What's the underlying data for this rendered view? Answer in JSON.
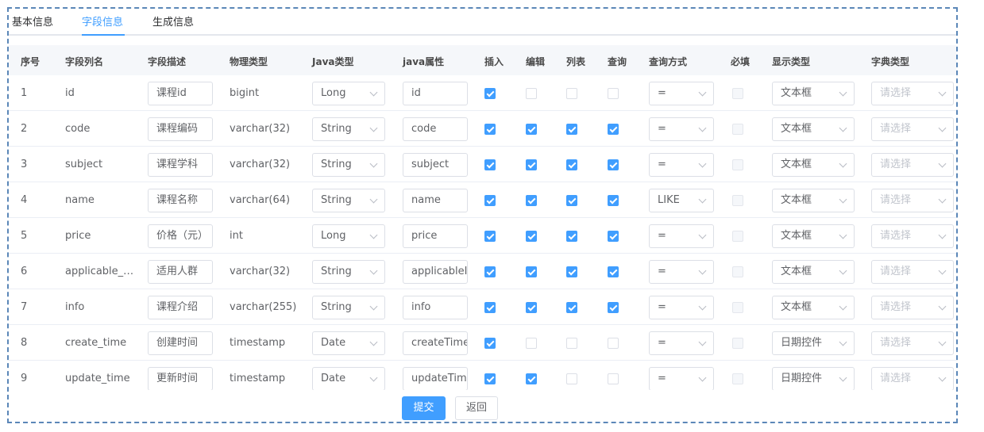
{
  "tabs": [
    {
      "label": "基本信息",
      "active": false
    },
    {
      "label": "字段信息",
      "active": true
    },
    {
      "label": "生成信息",
      "active": false
    }
  ],
  "table": {
    "headers": {
      "index": "序号",
      "column_name": "字段列名",
      "description": "字段描述",
      "physical_type": "物理类型",
      "java_type": "Java类型",
      "java_field": "java属性",
      "insert": "插入",
      "edit": "编辑",
      "list": "列表",
      "query": "查询",
      "query_type": "查询方式",
      "required": "必填",
      "display_type": "显示类型",
      "dict_type": "字典类型"
    },
    "dict_placeholder": "请选择",
    "rows": [
      {
        "index": "1",
        "column_name": "id",
        "description": "课程id",
        "physical_type": "bigint",
        "java_type": "Long",
        "java_field": "id",
        "insert": true,
        "edit": false,
        "list": false,
        "query": false,
        "query_type": "=",
        "required": false,
        "display_type": "文本框"
      },
      {
        "index": "2",
        "column_name": "code",
        "description": "课程编码",
        "physical_type": "varchar(32)",
        "java_type": "String",
        "java_field": "code",
        "insert": true,
        "edit": true,
        "list": true,
        "query": true,
        "query_type": "=",
        "required": false,
        "display_type": "文本框"
      },
      {
        "index": "3",
        "column_name": "subject",
        "description": "课程学科",
        "physical_type": "varchar(32)",
        "java_type": "String",
        "java_field": "subject",
        "insert": true,
        "edit": true,
        "list": true,
        "query": true,
        "query_type": "=",
        "required": false,
        "display_type": "文本框"
      },
      {
        "index": "4",
        "column_name": "name",
        "description": "课程名称",
        "physical_type": "varchar(64)",
        "java_type": "String",
        "java_field": "name",
        "insert": true,
        "edit": true,
        "list": true,
        "query": true,
        "query_type": "LIKE",
        "required": false,
        "display_type": "文本框"
      },
      {
        "index": "5",
        "column_name": "price",
        "description": "价格（元）",
        "physical_type": "int",
        "java_type": "Long",
        "java_field": "price",
        "insert": true,
        "edit": true,
        "list": true,
        "query": true,
        "query_type": "=",
        "required": false,
        "display_type": "文本框"
      },
      {
        "index": "6",
        "column_name": "applicable_…",
        "description": "适用人群",
        "physical_type": "varchar(32)",
        "java_type": "String",
        "java_field": "applicableI",
        "insert": true,
        "edit": true,
        "list": true,
        "query": true,
        "query_type": "=",
        "required": false,
        "display_type": "文本框"
      },
      {
        "index": "7",
        "column_name": "info",
        "description": "课程介绍",
        "physical_type": "varchar(255)",
        "java_type": "String",
        "java_field": "info",
        "insert": true,
        "edit": true,
        "list": true,
        "query": true,
        "query_type": "=",
        "required": false,
        "display_type": "文本框"
      },
      {
        "index": "8",
        "column_name": "create_time",
        "description": "创建时间",
        "physical_type": "timestamp",
        "java_type": "Date",
        "java_field": "createTime",
        "insert": true,
        "edit": false,
        "list": false,
        "query": false,
        "query_type": "=",
        "required": false,
        "display_type": "日期控件"
      },
      {
        "index": "9",
        "column_name": "update_time",
        "description": "更新时间",
        "physical_type": "timestamp",
        "java_type": "Date",
        "java_field": "updateTim",
        "insert": true,
        "edit": true,
        "list": false,
        "query": false,
        "query_type": "=",
        "required": false,
        "display_type": "日期控件"
      }
    ]
  },
  "footer": {
    "submit_label": "提交",
    "back_label": "返回"
  },
  "colors": {
    "accent": "#409eff",
    "frame_border": "#5b87b8"
  }
}
